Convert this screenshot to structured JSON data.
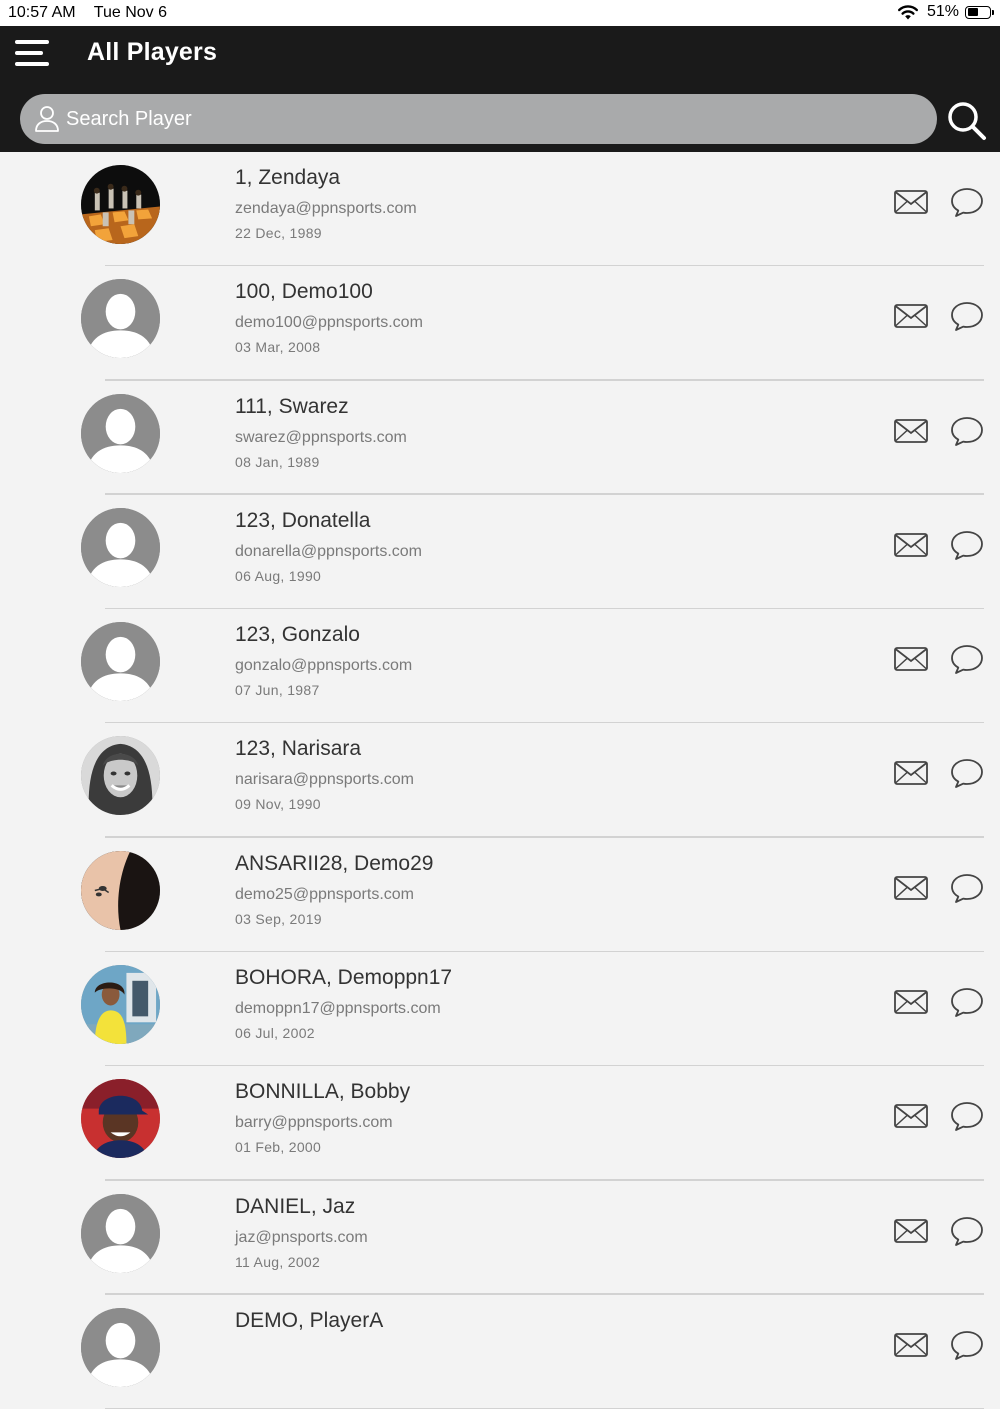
{
  "status_bar": {
    "time": "10:57 AM",
    "date": "Tue Nov 6",
    "battery": "51%",
    "battery_level": 0.51
  },
  "header": {
    "title": "All Players",
    "menu_icon": "hamburger-menu-icon",
    "search_icon": "magnifier-icon"
  },
  "search": {
    "placeholder": "Search Player",
    "value": ""
  },
  "players": [
    {
      "name": "1, Zendaya",
      "email": "zendaya@ppnsports.com",
      "dob": "22 Dec, 1989",
      "avatar": "chess"
    },
    {
      "name": "100, Demo100",
      "email": "demo100@ppnsports.com",
      "dob": "03 Mar, 2008",
      "avatar": "default"
    },
    {
      "name": "111, Swarez",
      "email": "swarez@ppnsports.com",
      "dob": "08 Jan, 1989",
      "avatar": "default"
    },
    {
      "name": "123, Donatella",
      "email": "donarella@ppnsports.com",
      "dob": "06 Aug, 1990",
      "avatar": "default"
    },
    {
      "name": "123, Gonzalo",
      "email": "gonzalo@ppnsports.com",
      "dob": "07 Jun, 1987",
      "avatar": "default"
    },
    {
      "name": "123, Narisara",
      "email": "narisara@ppnsports.com",
      "dob": "09 Nov, 1990",
      "avatar": "woman"
    },
    {
      "name": "ANSARII28, Demo29",
      "email": "demo25@ppnsports.com",
      "dob": "03 Sep, 2019",
      "avatar": "tattoo"
    },
    {
      "name": "BOHORA, Demoppn17",
      "email": "demoppn17@ppnsports.com",
      "dob": "06 Jul, 2002",
      "avatar": "yellow"
    },
    {
      "name": "BONNILLA, Bobby",
      "email": "barry@ppnsports.com",
      "dob": "01 Feb, 2000",
      "avatar": "player"
    },
    {
      "name": "DANIEL, Jaz",
      "email": "jaz@pnsports.com",
      "dob": "11 Aug, 2002",
      "avatar": "default"
    },
    {
      "name": "DEMO, PlayerA",
      "email": "",
      "dob": "",
      "avatar": "default"
    }
  ],
  "colors": {
    "header_bg": "#1a1a1a",
    "search_bg": "#a9aaab",
    "list_bg": "#f3f3f3"
  }
}
